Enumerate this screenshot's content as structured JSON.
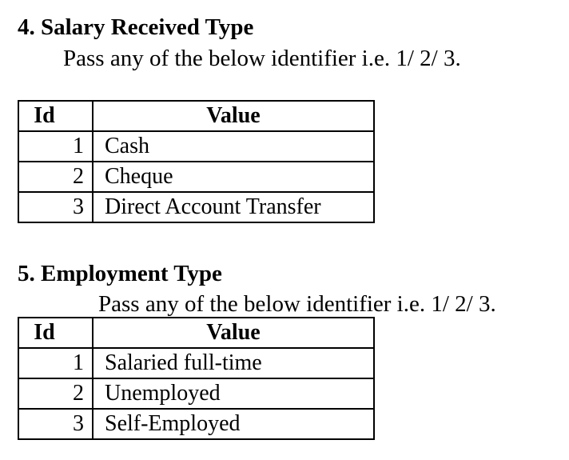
{
  "section4": {
    "title": "4. Salary Received Type",
    "note": "Pass any of the below identifier i.e. 1/ 2/ 3.",
    "headers": {
      "id": "Id",
      "value": "Value"
    },
    "rows": [
      {
        "id": "1",
        "value": "Cash"
      },
      {
        "id": "2",
        "value": "Cheque"
      },
      {
        "id": "3",
        "value": "Direct Account Transfer"
      }
    ]
  },
  "section5": {
    "title": "5. Employment Type",
    "note": "Pass any of the below identifier i.e. 1/ 2/ 3.",
    "headers": {
      "id": "Id",
      "value": "Value"
    },
    "rows": [
      {
        "id": "1",
        "value": "Salaried full-time"
      },
      {
        "id": "2",
        "value": "Unemployed"
      },
      {
        "id": "3",
        "value": "Self-Employed"
      }
    ]
  }
}
